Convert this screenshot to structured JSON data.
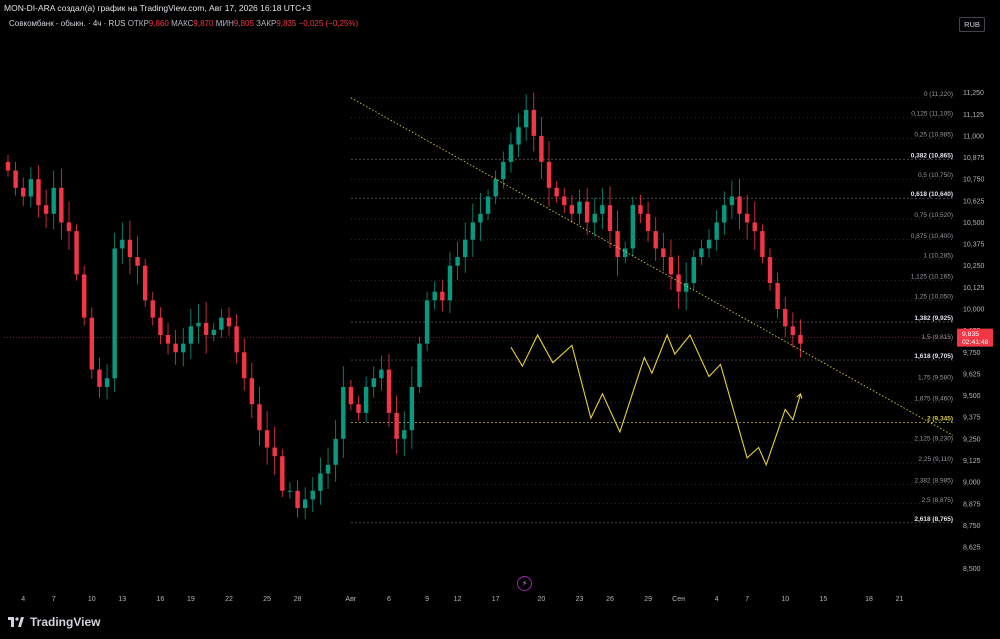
{
  "header": {
    "attribution": "MON-DI-ARA создал(а) график на TradingView.com, Авг 17, 2026 16:18 UTC+3",
    "symbol": "Совкомбанк - обыкн. · 4ч · RUS",
    "open_label": "ОТКР",
    "open_value": "9,860",
    "high_label": "МАКС",
    "high_value": "9,870",
    "low_label": "МИН",
    "low_value": "9,805",
    "close_label": "ЗАКР",
    "close_value": "9,835",
    "change": "−0,025 (−0,25%)",
    "currency": "RUB"
  },
  "brand": {
    "name": "TradingView"
  },
  "colors": {
    "up": "#089981",
    "down": "#f23645",
    "fib": "#b2b5be",
    "trendline": "#d4c84a",
    "projection": "#e6d23a",
    "price": "#f23645"
  },
  "chart_data": {
    "type": "candlestick",
    "ylim": [
      8.4,
      11.45
    ],
    "y_ticks": [
      "11,250",
      "11,125",
      "11,000",
      "10,875",
      "10,750",
      "10,625",
      "10,500",
      "10,375",
      "10,250",
      "10,125",
      "10,000",
      "9,875",
      "9,750",
      "9,625",
      "9,500",
      "9,375",
      "9,250",
      "9,125",
      "9,000",
      "8,875",
      "8,750",
      "8,625",
      "8,500"
    ],
    "y_tick_values": [
      11.25,
      11.125,
      11.0,
      10.875,
      10.75,
      10.625,
      10.5,
      10.375,
      10.25,
      10.125,
      10.0,
      9.875,
      9.75,
      9.625,
      9.5,
      9.375,
      9.25,
      9.125,
      9.0,
      8.875,
      8.75,
      8.625,
      8.5
    ],
    "x_ticks": [
      {
        "label": "4",
        "slot": 2
      },
      {
        "label": "7",
        "slot": 6
      },
      {
        "label": "10",
        "slot": 11
      },
      {
        "label": "13",
        "slot": 15
      },
      {
        "label": "16",
        "slot": 20
      },
      {
        "label": "19",
        "slot": 24
      },
      {
        "label": "22",
        "slot": 29
      },
      {
        "label": "25",
        "slot": 34
      },
      {
        "label": "28",
        "slot": 38
      },
      {
        "label": "Авг",
        "slot": 45
      },
      {
        "label": "6",
        "slot": 50
      },
      {
        "label": "9",
        "slot": 55
      },
      {
        "label": "12",
        "slot": 59
      },
      {
        "label": "17",
        "slot": 64
      },
      {
        "label": "20",
        "slot": 70
      },
      {
        "label": "23",
        "slot": 75
      },
      {
        "label": "26",
        "slot": 79
      },
      {
        "label": "29",
        "slot": 84
      },
      {
        "label": "Сен",
        "slot": 88
      },
      {
        "label": "4",
        "slot": 93
      },
      {
        "label": "7",
        "slot": 97
      },
      {
        "label": "10",
        "slot": 102
      },
      {
        "label": "15",
        "slot": 107
      },
      {
        "label": "18",
        "slot": 113
      },
      {
        "label": "21",
        "slot": 117
      }
    ],
    "closes": [
      10.8,
      10.7,
      10.65,
      10.75,
      10.6,
      10.55,
      10.7,
      10.5,
      10.45,
      10.2,
      9.95,
      9.65,
      9.55,
      9.6,
      10.35,
      10.4,
      10.3,
      10.25,
      10.05,
      9.95,
      9.85,
      9.8,
      9.75,
      9.8,
      9.9,
      9.92,
      9.85,
      9.88,
      9.95,
      9.9,
      9.75,
      9.6,
      9.45,
      9.3,
      9.2,
      9.15,
      8.95,
      8.95,
      8.85,
      8.9,
      8.95,
      9.05,
      9.1,
      9.25,
      9.55,
      9.45,
      9.4,
      9.55,
      9.6,
      9.65,
      9.4,
      9.25,
      9.3,
      9.55,
      9.8,
      10.05,
      10.1,
      10.05,
      10.25,
      10.3,
      10.4,
      10.5,
      10.55,
      10.65,
      10.75,
      10.85,
      10.95,
      11.05,
      11.15,
      11.0,
      10.85,
      10.7,
      10.65,
      10.6,
      10.55,
      10.62,
      10.5,
      10.55,
      10.6,
      10.45,
      10.3,
      10.35,
      10.6,
      10.55,
      10.45,
      10.35,
      10.3,
      10.2,
      10.1,
      10.15,
      10.3,
      10.35,
      10.4,
      10.5,
      10.6,
      10.65,
      10.55,
      10.5,
      10.45,
      10.3,
      10.15,
      10.0,
      9.9,
      9.85,
      9.8
    ],
    "fib_levels": [
      {
        "label": "0 (11,220)",
        "value": 11.22,
        "bold": false
      },
      {
        "label": "0,125 (11,105)",
        "value": 11.105,
        "bold": false
      },
      {
        "label": "0,25 (10,985)",
        "value": 10.985,
        "bold": false
      },
      {
        "label": "0,382 (10,865)",
        "value": 10.865,
        "bold": true
      },
      {
        "label": "0,5 (10,750)",
        "value": 10.75,
        "bold": false
      },
      {
        "label": "0,618 (10,640)",
        "value": 10.64,
        "bold": true
      },
      {
        "label": "0,75 (10,520)",
        "value": 10.52,
        "bold": false
      },
      {
        "label": "0,875 (10,400)",
        "value": 10.4,
        "bold": false
      },
      {
        "label": "1 (10,285)",
        "value": 10.285,
        "bold": false
      },
      {
        "label": "1,125 (10,165)",
        "value": 10.165,
        "bold": false
      },
      {
        "label": "1,25 (10,050)",
        "value": 10.05,
        "bold": false
      },
      {
        "label": "1,382 (9,925)",
        "value": 9.925,
        "bold": true
      },
      {
        "label": "1,5 (9,815)",
        "value": 9.815,
        "bold": false
      },
      {
        "label": "1,618 (9,705)",
        "value": 9.705,
        "bold": true
      },
      {
        "label": "1,75 (9,580)",
        "value": 9.58,
        "bold": false
      },
      {
        "label": "1,875 (9,460)",
        "value": 9.46,
        "bold": false
      },
      {
        "label": "2 (9,345)",
        "value": 9.345,
        "bold": true
      },
      {
        "label": "2,125 (9,230)",
        "value": 9.23,
        "bold": false
      },
      {
        "label": "2,25 (9,110)",
        "value": 9.11,
        "bold": false
      },
      {
        "label": "2,382 (8,985)",
        "value": 8.985,
        "bold": false
      },
      {
        "label": "2,5 (8,875)",
        "value": 8.875,
        "bold": false
      },
      {
        "label": "2,618 (8,765)",
        "value": 8.765,
        "bold": true
      }
    ],
    "current_price": {
      "value": 9.835,
      "label": "9,835",
      "countdown": "02:41:48"
    },
    "trendline": [
      {
        "slot": 45,
        "value": 11.22
      },
      {
        "slot": 124,
        "value": 9.27
      }
    ],
    "projection": [
      {
        "slot": 66,
        "value": 9.78
      },
      {
        "slot": 67.5,
        "value": 9.67
      },
      {
        "slot": 69.5,
        "value": 9.85
      },
      {
        "slot": 71.5,
        "value": 9.69
      },
      {
        "slot": 74,
        "value": 9.79
      },
      {
        "slot": 76.5,
        "value": 9.37
      },
      {
        "slot": 78,
        "value": 9.51
      },
      {
        "slot": 80.3,
        "value": 9.29
      },
      {
        "slot": 83.5,
        "value": 9.72
      },
      {
        "slot": 84.5,
        "value": 9.63
      },
      {
        "slot": 86.5,
        "value": 9.85
      },
      {
        "slot": 87.5,
        "value": 9.74
      },
      {
        "slot": 89.5,
        "value": 9.85
      },
      {
        "slot": 92,
        "value": 9.61
      },
      {
        "slot": 93.5,
        "value": 9.68
      },
      {
        "slot": 97,
        "value": 9.14
      },
      {
        "slot": 98.5,
        "value": 9.2
      },
      {
        "slot": 99.5,
        "value": 9.1
      },
      {
        "slot": 102,
        "value": 9.42
      },
      {
        "slot": 103,
        "value": 9.36
      },
      {
        "slot": 104,
        "value": 9.51
      }
    ]
  }
}
